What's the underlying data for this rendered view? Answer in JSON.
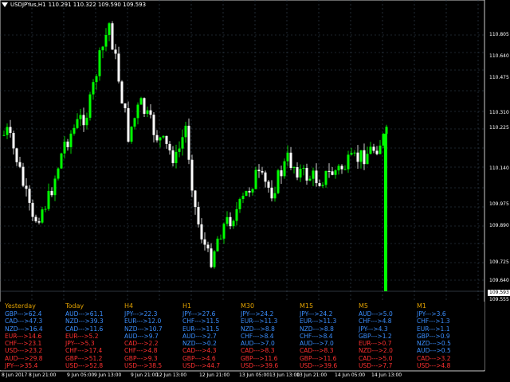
{
  "header": {
    "symbol": "USDJPYus,H1",
    "ohlc": "110.291 110.322 109.590 109.593"
  },
  "colors": {
    "bull": "#00ff00",
    "bear": "#ffffff",
    "grid": "#3a4a5a",
    "strong": "#3b8fff",
    "weak": "#ff3030",
    "heading": "#e0a000"
  },
  "price_labels": [
    "110.805",
    "110.640",
    "110.475",
    "110.310",
    "110.225",
    "110.140",
    "109.975",
    "109.890",
    "109.725",
    "109.640",
    "109.555"
  ],
  "current_price": "109.593",
  "time_labels": [
    "8 Jun 2017",
    "8 Jun 21:00",
    "9 Jun 05:00",
    "9 Jun 13:00",
    "9 Jun 21:00",
    "12 Jun 13:00",
    "12 Jun 21:00",
    "13 Jun 05:00",
    "13 Jun 13:00",
    "13 Jun 21:00",
    "14 Jun 05:00",
    "14 Jun 13:00"
  ],
  "strength_panel": [
    {
      "title": "Yesterday",
      "rows": [
        {
          "t": "GBP--->62.4",
          "s": "strong"
        },
        {
          "t": "CAD--->47.3",
          "s": "strong"
        },
        {
          "t": "NZD--->16.4",
          "s": "strong"
        },
        {
          "t": "EUR--->14.6",
          "s": "weak"
        },
        {
          "t": "CHF--->23.1",
          "s": "weak"
        },
        {
          "t": "USD--->23.2",
          "s": "weak"
        },
        {
          "t": "AUD--->29.8",
          "s": "weak"
        },
        {
          "t": "JPY--->35.4",
          "s": "weak"
        }
      ]
    },
    {
      "title": "Today",
      "rows": [
        {
          "t": "AUD--->61.1",
          "s": "strong"
        },
        {
          "t": "NZD--->39.3",
          "s": "strong"
        },
        {
          "t": "CAD--->11.6",
          "s": "strong"
        },
        {
          "t": "EUR--->5.2",
          "s": "weak"
        },
        {
          "t": "JPY--->5.3",
          "s": "weak"
        },
        {
          "t": "CHF--->17.4",
          "s": "weak"
        },
        {
          "t": "GBP--->51.2",
          "s": "weak"
        },
        {
          "t": "USD--->52.8",
          "s": "weak"
        }
      ]
    },
    {
      "title": "H4",
      "rows": [
        {
          "t": "JPY--->22.3",
          "s": "strong"
        },
        {
          "t": "EUR--->12.0",
          "s": "strong"
        },
        {
          "t": "NZD--->10.7",
          "s": "strong"
        },
        {
          "t": "AUD--->9.7",
          "s": "strong"
        },
        {
          "t": "CAD--->2.2",
          "s": "weak"
        },
        {
          "t": "CHF--->4.8",
          "s": "weak"
        },
        {
          "t": "GBP--->9.3",
          "s": "weak"
        },
        {
          "t": "USD--->38.5",
          "s": "weak"
        }
      ]
    },
    {
      "title": "H1",
      "rows": [
        {
          "t": "JPY--->27.6",
          "s": "strong"
        },
        {
          "t": "CHF--->11.5",
          "s": "strong"
        },
        {
          "t": "EUR--->11.5",
          "s": "strong"
        },
        {
          "t": "AUD--->2.7",
          "s": "strong"
        },
        {
          "t": "NZD--->0.2",
          "s": "strong"
        },
        {
          "t": "CAD--->4.3",
          "s": "weak"
        },
        {
          "t": "GBP--->4.6",
          "s": "weak"
        },
        {
          "t": "USD--->44.7",
          "s": "weak"
        }
      ]
    },
    {
      "title": "M30",
      "rows": [
        {
          "t": "JPY--->24.2",
          "s": "strong"
        },
        {
          "t": "EUR--->11.3",
          "s": "strong"
        },
        {
          "t": "NZD--->8.8",
          "s": "strong"
        },
        {
          "t": "CHF--->8.4",
          "s": "strong"
        },
        {
          "t": "AUD--->7.0",
          "s": "strong"
        },
        {
          "t": "CAD--->8.3",
          "s": "weak"
        },
        {
          "t": "GBP--->11.6",
          "s": "weak"
        },
        {
          "t": "USD--->39.6",
          "s": "weak"
        }
      ]
    },
    {
      "title": "M15",
      "rows": [
        {
          "t": "JPY--->24.2",
          "s": "strong"
        },
        {
          "t": "EUR--->11.3",
          "s": "strong"
        },
        {
          "t": "NZD--->8.8",
          "s": "strong"
        },
        {
          "t": "CHF--->8.4",
          "s": "strong"
        },
        {
          "t": "AUD--->7.0",
          "s": "strong"
        },
        {
          "t": "CAD--->8.3",
          "s": "weak"
        },
        {
          "t": "GBP--->11.6",
          "s": "weak"
        },
        {
          "t": "USD--->39.6",
          "s": "weak"
        }
      ]
    },
    {
      "title": "M5",
      "rows": [
        {
          "t": "AUD--->5.0",
          "s": "strong"
        },
        {
          "t": "CHF--->4.8",
          "s": "strong"
        },
        {
          "t": "JPY--->4.3",
          "s": "strong"
        },
        {
          "t": "GBP--->1.2",
          "s": "strong"
        },
        {
          "t": "EUR--->0.7",
          "s": "weak"
        },
        {
          "t": "NZD--->2.0",
          "s": "weak"
        },
        {
          "t": "CAD--->5.0",
          "s": "weak"
        },
        {
          "t": "USD--->7.7",
          "s": "weak"
        }
      ]
    },
    {
      "title": "M1",
      "rows": [
        {
          "t": "JPY--->3.6",
          "s": "strong"
        },
        {
          "t": "CHF--->1.3",
          "s": "strong"
        },
        {
          "t": "EUR--->1.1",
          "s": "strong"
        },
        {
          "t": "GBP--->0.9",
          "s": "strong"
        },
        {
          "t": "NZD--->0.5",
          "s": "strong"
        },
        {
          "t": "AUD--->0.5",
          "s": "strong"
        },
        {
          "t": "CAD--->3.2",
          "s": "weak"
        },
        {
          "t": "USD--->4.8",
          "s": "weak"
        }
      ]
    }
  ]
}
